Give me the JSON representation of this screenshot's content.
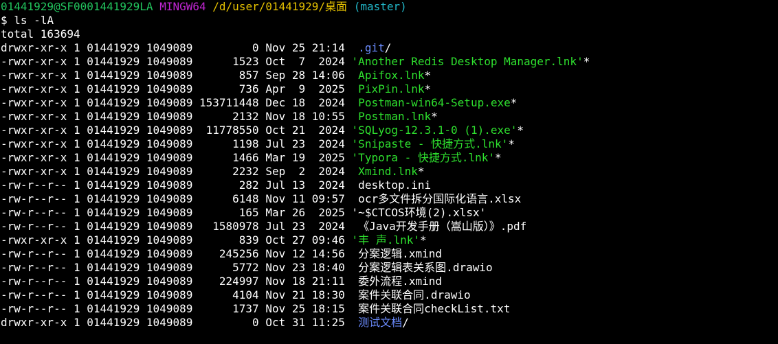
{
  "prompt": {
    "user_host": "01441929@SF0001441929LA",
    "system": "MINGW64",
    "path": "/d/user/01441929/桌面",
    "branch": "(master)",
    "symbol": "$",
    "command": "ls -lA"
  },
  "total": "total 163694",
  "entries": [
    {
      "meta": "drwxr-xr-x 1 01441929 1049089         0 Nov 25 21:14 ",
      "name": " .git",
      "suffix": "/",
      "kind": "dir"
    },
    {
      "meta": "-rwxr-xr-x 1 01441929 1049089      1523 Oct  7  2024 ",
      "name": "'Another Redis Desktop Manager.lnk'",
      "suffix": "*",
      "kind": "exec"
    },
    {
      "meta": "-rwxr-xr-x 1 01441929 1049089       857 Sep 28 14:06 ",
      "name": " Apifox.lnk",
      "suffix": "*",
      "kind": "exec"
    },
    {
      "meta": "-rwxr-xr-x 1 01441929 1049089       736 Apr  9  2025 ",
      "name": " PixPin.lnk",
      "suffix": "*",
      "kind": "exec"
    },
    {
      "meta": "-rwxr-xr-x 1 01441929 1049089 153711448 Dec 18  2024 ",
      "name": " Postman-win64-Setup.exe",
      "suffix": "*",
      "kind": "exec"
    },
    {
      "meta": "-rwxr-xr-x 1 01441929 1049089      2132 Nov 18 10:55 ",
      "name": " Postman.lnk",
      "suffix": "*",
      "kind": "exec"
    },
    {
      "meta": "-rwxr-xr-x 1 01441929 1049089  11778550 Oct 21  2024 ",
      "name": "'SQLyog-12.3.1-0 (1).exe'",
      "suffix": "*",
      "kind": "exec"
    },
    {
      "meta": "-rwxr-xr-x 1 01441929 1049089      1198 Jul 23  2024 ",
      "name": "'Snipaste - 快捷方式.lnk'",
      "suffix": "*",
      "kind": "exec"
    },
    {
      "meta": "-rwxr-xr-x 1 01441929 1049089      1466 Mar 19  2025 ",
      "name": "'Typora - 快捷方式.lnk'",
      "suffix": "*",
      "kind": "exec"
    },
    {
      "meta": "-rwxr-xr-x 1 01441929 1049089      2232 Sep  2  2024 ",
      "name": " Xmind.lnk",
      "suffix": "*",
      "kind": "exec"
    },
    {
      "meta": "-rw-r--r-- 1 01441929 1049089       282 Jul 13  2024 ",
      "name": " desktop.ini",
      "suffix": "",
      "kind": "plain"
    },
    {
      "meta": "-rw-r--r-- 1 01441929 1049089      6148 Nov 11 09:57 ",
      "name": " ocr多文件拆分国际化语言.xlsx",
      "suffix": "",
      "kind": "plain"
    },
    {
      "meta": "-rw-r--r-- 1 01441929 1049089       165 Mar 26  2025 ",
      "name": "'~$CTCOS环境(2).xlsx'",
      "suffix": "",
      "kind": "plain"
    },
    {
      "meta": "-rw-r--r-- 1 01441929 1049089   1580978 Jul 23  2024 ",
      "name": " 《Java开发手册（嵩山版）》.pdf",
      "suffix": "",
      "kind": "plain"
    },
    {
      "meta": "-rwxr-xr-x 1 01441929 1049089       839 Oct 27 09:46 ",
      "name": "'丰 声.lnk'",
      "suffix": "*",
      "kind": "exec"
    },
    {
      "meta": "-rw-r--r-- 1 01441929 1049089    245256 Nov 12 14:56 ",
      "name": " 分案逻辑.xmind",
      "suffix": "",
      "kind": "plain"
    },
    {
      "meta": "-rw-r--r-- 1 01441929 1049089      5772 Nov 23 18:40 ",
      "name": " 分案逻辑表关系图.drawio",
      "suffix": "",
      "kind": "plain"
    },
    {
      "meta": "-rw-r--r-- 1 01441929 1049089    224997 Nov 18 21:11 ",
      "name": " 委外流程.xmind",
      "suffix": "",
      "kind": "plain"
    },
    {
      "meta": "-rw-r--r-- 1 01441929 1049089      4104 Nov 21 18:30 ",
      "name": " 案件关联合同.drawio",
      "suffix": "",
      "kind": "plain"
    },
    {
      "meta": "-rw-r--r-- 1 01441929 1049089      1737 Nov 25 18:15 ",
      "name": " 案件关联合同checkList.txt",
      "suffix": "",
      "kind": "plain"
    },
    {
      "meta": "drwxr-xr-x 1 01441929 1049089         0 Oct 31 11:25 ",
      "name": " 测试文档",
      "suffix": "/",
      "kind": "dir"
    }
  ],
  "colors": {
    "background": "#000000",
    "prompt_user": "#22c55e",
    "prompt_system": "#c026d3",
    "prompt_path": "#e5c100",
    "prompt_branch": "#22b8c9",
    "executable": "#2ee02e",
    "directory": "#6b8cff",
    "plain": "#ffffff"
  }
}
